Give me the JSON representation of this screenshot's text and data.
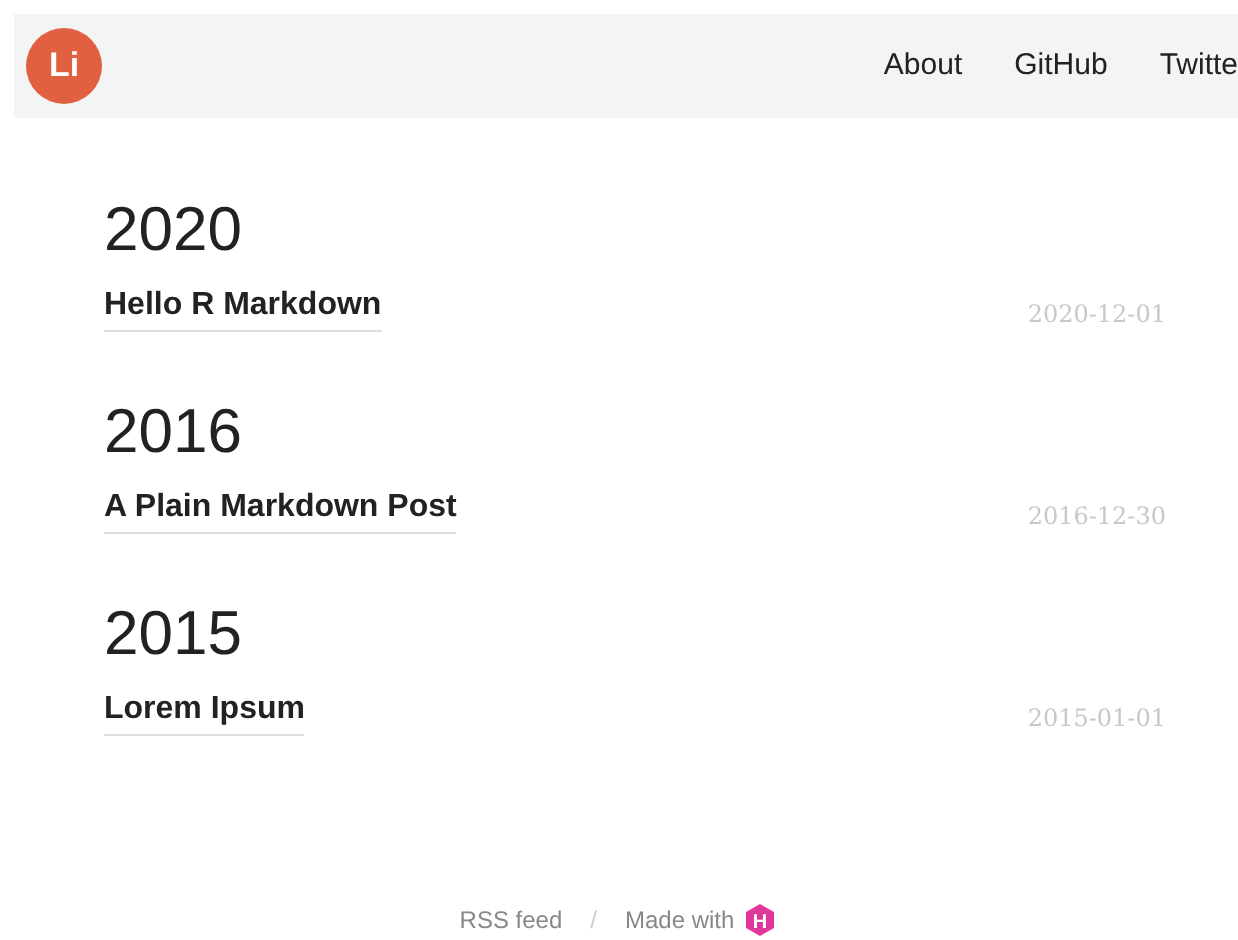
{
  "logo": "Li",
  "nav": [
    "About",
    "GitHub",
    "Twitte"
  ],
  "sections": [
    {
      "year": "2020",
      "posts": [
        {
          "title": "Hello R Markdown",
          "date": "2020-12-01"
        }
      ]
    },
    {
      "year": "2016",
      "posts": [
        {
          "title": "A Plain Markdown Post",
          "date": "2016-12-30"
        }
      ]
    },
    {
      "year": "2015",
      "posts": [
        {
          "title": "Lorem Ipsum",
          "date": "2015-01-01"
        }
      ]
    }
  ],
  "footer": {
    "rss": "RSS feed",
    "separator": "/",
    "made_with": "Made with",
    "made_with_icon_letter": "H"
  }
}
